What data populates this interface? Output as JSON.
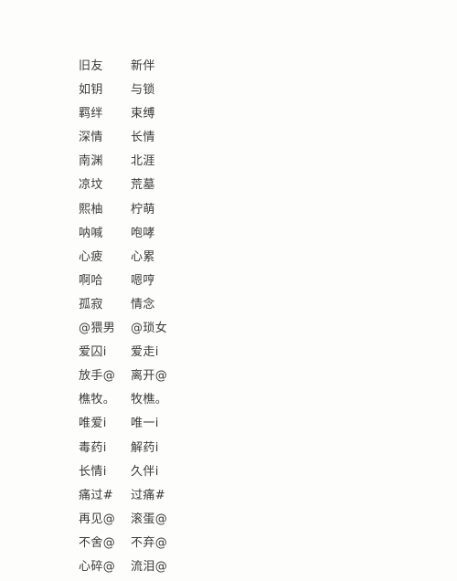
{
  "document": {
    "kind": "text-list",
    "background_color": "#fdfefb",
    "text_color": "#3a3a3a",
    "row_count": 22
  },
  "rows": [
    {
      "left": "旧友",
      "right": "新伴"
    },
    {
      "left": "如钥",
      "right": "与锁"
    },
    {
      "left": "羁绊",
      "right": "束缚"
    },
    {
      "left": "深情",
      "right": "长情"
    },
    {
      "left": "南渊",
      "right": "北涯"
    },
    {
      "left": "凉坟",
      "right": "荒墓"
    },
    {
      "left": "熙柚",
      "right": "柠萌"
    },
    {
      "left": "呐喊",
      "right": "咆哮"
    },
    {
      "left": "心疲",
      "right": "心累"
    },
    {
      "left": "啊哈",
      "right": "嗯哼"
    },
    {
      "left": "孤寂",
      "right": "情念"
    },
    {
      "left": "@猥男",
      "right": "@琐女"
    },
    {
      "left": "爱囚i",
      "right": "爱走i"
    },
    {
      "left": "放手@",
      "right": "离开@"
    },
    {
      "left": "樵牧。",
      "right": "牧樵。"
    },
    {
      "left": "唯爱i",
      "right": "唯一i"
    },
    {
      "left": "毒药i",
      "right": "解药i"
    },
    {
      "left": "长情i",
      "right": "久伴i"
    },
    {
      "left": "痛过#",
      "right": "过痛#"
    },
    {
      "left": "再见@",
      "right": "滚蛋@"
    },
    {
      "left": "不舍@",
      "right": "不弃@"
    },
    {
      "left": "心碎@",
      "right": "流泪@"
    }
  ]
}
